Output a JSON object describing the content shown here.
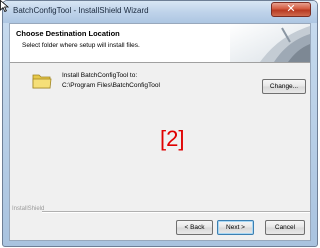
{
  "window": {
    "title": "BatchConfigTool - InstallShield Wizard",
    "close_glyph": "✕"
  },
  "header": {
    "title": "Choose Destination Location",
    "subtitle": "Select folder where setup will install files."
  },
  "content": {
    "folder_icon": "folder-icon",
    "install_label": "Install BatchConfigTool to:",
    "install_path": "C:\\Program Files\\BatchConfigTool",
    "change_button": "Change..."
  },
  "annotation": "[2]",
  "footer": {
    "brand": "InstallShield",
    "back_button": "< Back",
    "next_button": "Next >",
    "cancel_button": "Cancel"
  },
  "colors": {
    "annotation": "#e00000",
    "close_button": "#c8492f",
    "title_bar": "#bfd3ea"
  }
}
